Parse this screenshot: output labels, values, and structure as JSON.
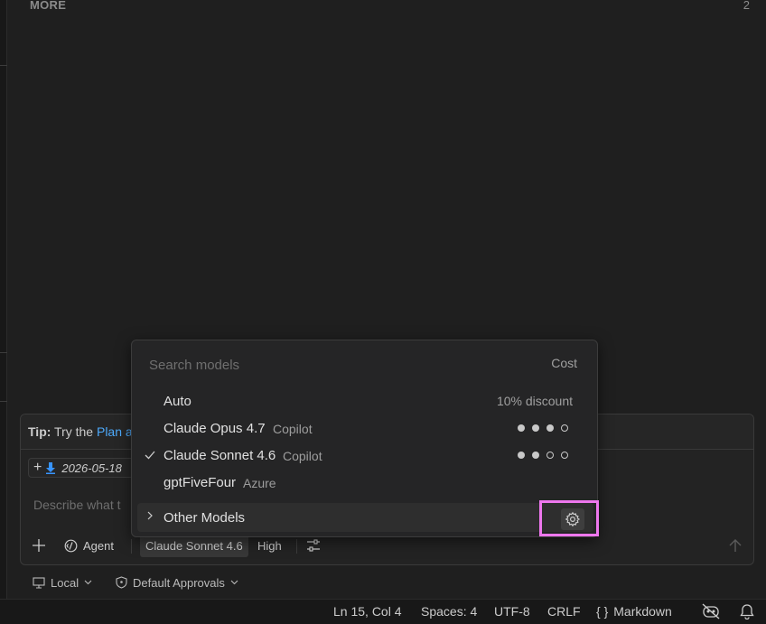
{
  "section": {
    "title": "MORE",
    "count": "2"
  },
  "chat": {
    "tip_bold": "Tip:",
    "tip_text": "Try the",
    "tip_link": "Plan a",
    "context_chip_date": "2026-05-18",
    "input_placeholder": "Describe what t",
    "toolbar": {
      "agent_label": "Agent",
      "model_label": "Claude Sonnet 4.6",
      "effort_label": "High"
    },
    "bottom": {
      "location_label": "Local",
      "approvals_label": "Default Approvals"
    }
  },
  "model_picker": {
    "search_placeholder": "Search models",
    "cost_header": "Cost",
    "models": [
      {
        "name": "Auto",
        "provider": "",
        "cost_text": "10% discount",
        "cost_level": null,
        "selected": false
      },
      {
        "name": "Claude Opus 4.7",
        "provider": "Copilot",
        "cost_text": "",
        "cost_level": 3,
        "selected": false
      },
      {
        "name": "Claude Sonnet 4.6",
        "provider": "Copilot",
        "cost_text": "",
        "cost_level": 2,
        "selected": true
      },
      {
        "name": "gptFiveFour",
        "provider": "Azure",
        "cost_text": "",
        "cost_level": null,
        "selected": false
      }
    ],
    "cost_max": 4,
    "other_models_label": "Other Models"
  },
  "status_bar": {
    "position": "Ln 15, Col 4",
    "spaces": "Spaces: 4",
    "encoding": "UTF-8",
    "eol": "CRLF",
    "language_braces": "{ }",
    "language": "Markdown"
  },
  "colors": {
    "accent_link": "#4daafc",
    "highlight_box": "#ee77ee"
  }
}
